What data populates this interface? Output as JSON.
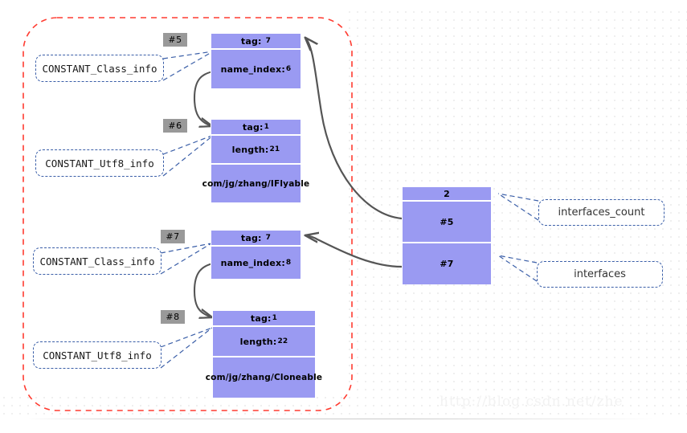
{
  "diagram": {
    "title": "Java class file constant pool interfaces diagram",
    "colors": {
      "cell_fill": "#9a9af2",
      "badge_fill": "#999999",
      "callout_border": "#3b5fa8",
      "group_border": "#ff3b30",
      "arrow": "#555555"
    },
    "group_box": {
      "label": "constant-pool group region"
    },
    "entries": [
      {
        "id": "entry-5",
        "badge": "#5",
        "callout": "CONSTANT_Class_info",
        "rows": [
          {
            "name": "tag",
            "label": "tag:",
            "value": "7"
          },
          {
            "name": "name_index",
            "label": "name_index:",
            "value": "6"
          }
        ]
      },
      {
        "id": "entry-6",
        "badge": "#6",
        "callout": "CONSTANT_Utf8_info",
        "rows": [
          {
            "name": "tag",
            "label": "tag:",
            "value": "1"
          },
          {
            "name": "length",
            "label": "length:",
            "value": "21"
          },
          {
            "name": "bytes",
            "label": "com/jg/zhang/IFlyable",
            "value": ""
          }
        ]
      },
      {
        "id": "entry-7",
        "badge": "#7",
        "callout": "CONSTANT_Class_info",
        "rows": [
          {
            "name": "tag",
            "label": "tag:",
            "value": "7"
          },
          {
            "name": "name_index",
            "label": "name_index:",
            "value": "8"
          }
        ]
      },
      {
        "id": "entry-8",
        "badge": "#8",
        "callout": "CONSTANT_Utf8_info",
        "rows": [
          {
            "name": "tag",
            "label": "tag:",
            "value": "1"
          },
          {
            "name": "length",
            "label": "length:",
            "value": "22"
          },
          {
            "name": "bytes",
            "label": "com/jg/zhang/Cloneable",
            "value": ""
          }
        ]
      }
    ],
    "interfaces_table": {
      "count_cell": "2",
      "ref_cells": [
        "#5",
        "#7"
      ],
      "callouts": {
        "count": "interfaces_count",
        "list": "interfaces"
      }
    },
    "watermark": "http://blog.csdn.net/zhe"
  }
}
